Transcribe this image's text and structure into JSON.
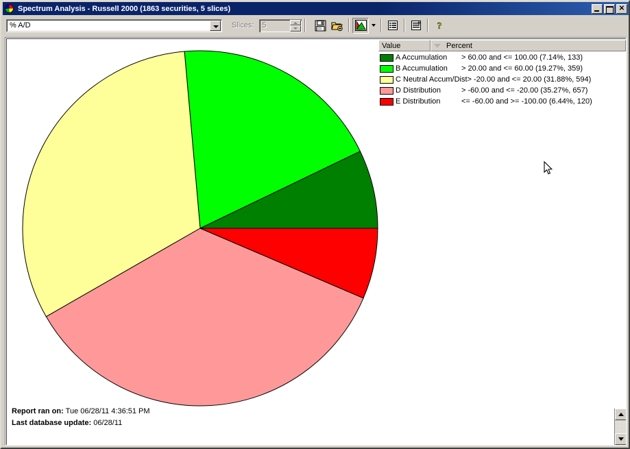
{
  "window": {
    "title": "Spectrum Analysis - Russell 2000 (1863 securities, 5 slices)",
    "icon": "pie-chart-icon",
    "minimize_label": "",
    "maximize_label": "",
    "close_label": "✕"
  },
  "toolbar": {
    "field_select": {
      "value": "% A/D",
      "arrow_icon": "chevron-down-icon"
    },
    "slices": {
      "label": "Slices:",
      "value": "5",
      "disabled": true
    },
    "buttons": [
      {
        "name": "save-button",
        "icon": "floppy-disk-icon"
      },
      {
        "name": "open-button",
        "icon": "open-folder-icon"
      },
      {
        "name": "chart-type-button",
        "icon": "pie-chart-icon",
        "pressed": true
      },
      {
        "name": "chart-type-dropdown",
        "icon": "chevron-down-icon"
      },
      {
        "name": "list-view-button",
        "icon": "list-icon"
      },
      {
        "name": "add-report-button",
        "icon": "list-plus-icon"
      },
      {
        "name": "help-button",
        "icon": "question-mark-icon"
      }
    ]
  },
  "legend": {
    "columns": [
      "Value",
      "Percent"
    ],
    "sort_indicator": "sort-descending-icon",
    "rows": [
      {
        "color": "#008000",
        "name": "A Accumulation",
        "range": "> 60.00 and <= 100.00 (7.14%, 133)"
      },
      {
        "color": "#00FF00",
        "name": "B Accumulation",
        "range": "> 20.00 and <= 60.00 (19.27%, 359)"
      },
      {
        "color": "#FFFF99",
        "name": "C Neutral Accum/Dist",
        "range": "> -20.00 and <= 20.00 (31.88%, 594)"
      },
      {
        "color": "#FF9999",
        "name": "D Distribution",
        "range": "> -60.00 and <= -20.00 (35.27%, 657)"
      },
      {
        "color": "#FF0000",
        "name": "E Distribution",
        "range": "<= -60.00 and >= -100.00 (6.44%, 120)"
      }
    ]
  },
  "footer": {
    "report_ran_label": "Report ran on:",
    "report_ran_value": "Tue 06/28/11 4:36:51 PM",
    "last_update_label": "Last database update:",
    "last_update_value": "06/28/11"
  },
  "chart_data": {
    "type": "pie",
    "title": "Spectrum Analysis - Russell 2000",
    "total_securities": 1863,
    "slice_count": 5,
    "start_angle_deg": 0,
    "direction": "counterclockwise",
    "labels": [
      "A Accumulation",
      "B Accumulation",
      "C Neutral Accum/Dist",
      "D Distribution",
      "E Distribution"
    ],
    "values": [
      7.14,
      19.27,
      31.88,
      35.27,
      6.44
    ],
    "counts": [
      133,
      359,
      594,
      657,
      120
    ],
    "colors": [
      "#008000",
      "#00FF00",
      "#FFFF99",
      "#FF9999",
      "#FF0000"
    ],
    "ranges": [
      "> 60.00 and <= 100.00",
      "> 20.00 and <= 60.00",
      "> -20.00 and <= 20.00",
      "> -60.00 and <= -20.00",
      "<= -60.00 and >= -100.00"
    ],
    "legend_position": "top-right",
    "value_unit": "percent"
  }
}
